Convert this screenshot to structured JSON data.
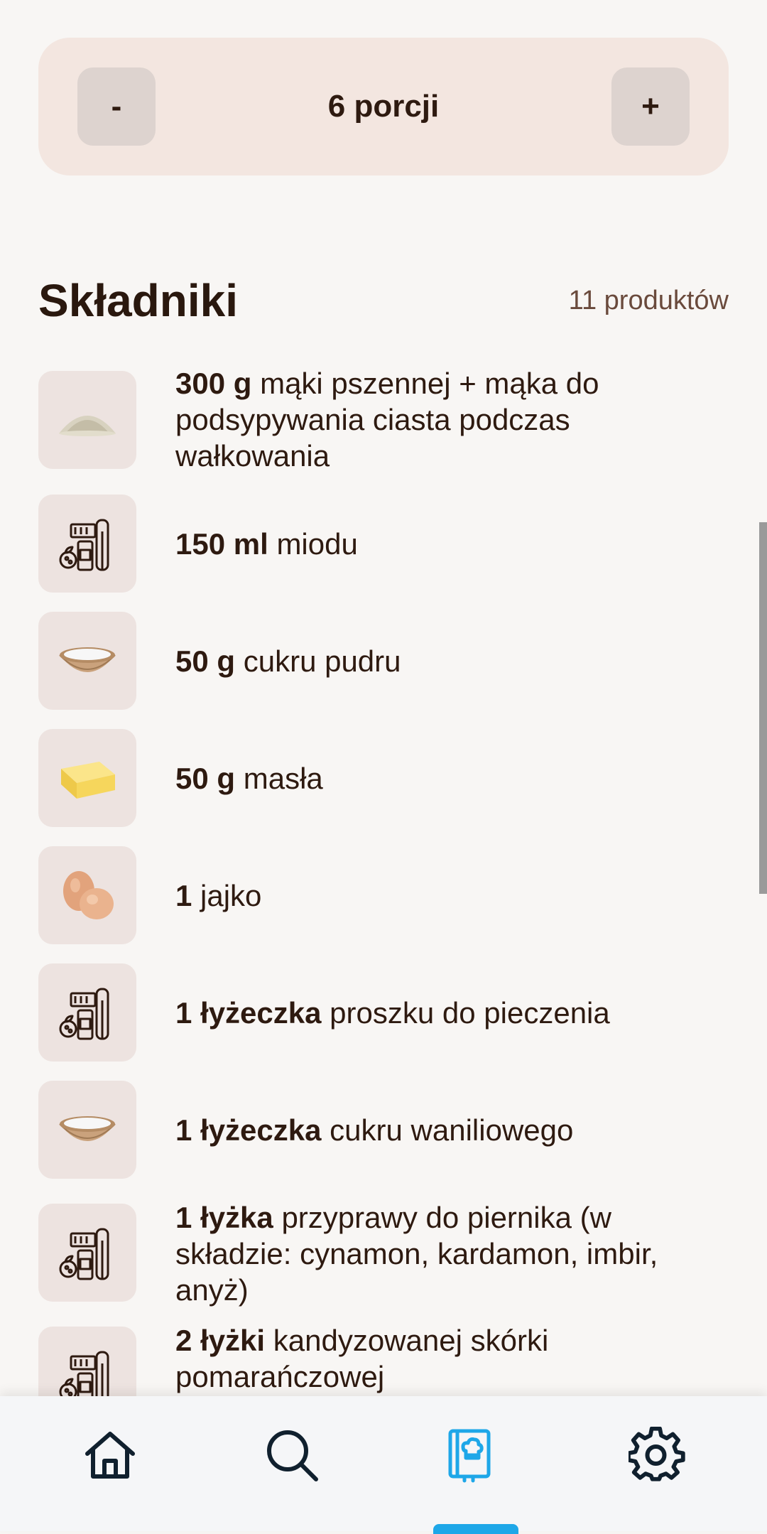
{
  "servings": {
    "minus_label": "-",
    "plus_label": "+",
    "value_label": "6 porcji"
  },
  "ingredients_section": {
    "title": "Składniki",
    "count_label": "11 produktów"
  },
  "ingredients": [
    {
      "amount": "300 g",
      "name": "mąki pszennej + mąka do podsypywania ciasta podczas wałkowania",
      "icon": "flour-icon"
    },
    {
      "amount": "150 ml",
      "name": "miodu",
      "icon": "groceries-icon"
    },
    {
      "amount": "50 g",
      "name": "cukru pudru",
      "icon": "sugar-bowl-icon"
    },
    {
      "amount": "50 g",
      "name": "masła",
      "icon": "butter-icon"
    },
    {
      "amount": "1",
      "name": "jajko",
      "icon": "eggs-icon"
    },
    {
      "amount": "1 łyżeczka",
      "name": "proszku do pieczenia",
      "icon": "groceries-icon"
    },
    {
      "amount": "1 łyżeczka",
      "name": "cukru waniliowego",
      "icon": "sugar-bowl-icon"
    },
    {
      "amount": "1 łyżka",
      "name": "przyprawy do piernika (w składzie: cynamon, kardamon, imbir, anyż)",
      "icon": "groceries-icon"
    },
    {
      "amount": "2 łyżki",
      "name": "kandyzowanej skórki pomarańczowej",
      "icon": "groceries-icon"
    }
  ],
  "nav": [
    {
      "id": "home",
      "icon": "home-icon",
      "active": false
    },
    {
      "id": "search",
      "icon": "search-icon",
      "active": false
    },
    {
      "id": "recipes",
      "icon": "recipe-book-icon",
      "active": true
    },
    {
      "id": "settings",
      "icon": "gear-icon",
      "active": false
    }
  ],
  "colors": {
    "background": "#f8f6f4",
    "accent": "#1ea7e8",
    "text": "#2e1a10"
  }
}
